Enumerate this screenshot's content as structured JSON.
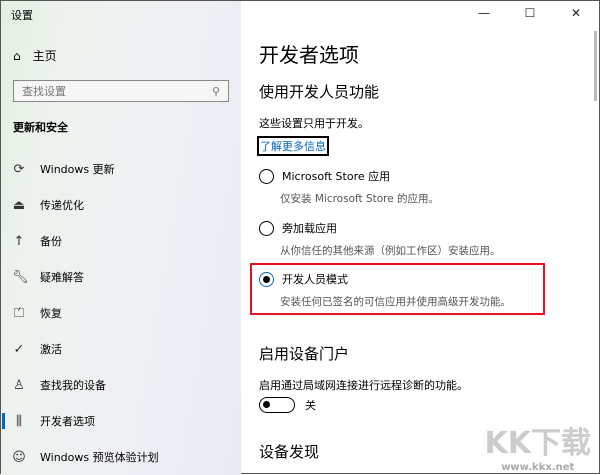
{
  "window": {
    "title": "设置",
    "minimize": "—",
    "maximize": "☐",
    "close": "✕"
  },
  "sidebar": {
    "home": "主页",
    "search_placeholder": "查找设置",
    "section": "更新和安全",
    "items": [
      {
        "label": "Windows 更新",
        "icon": "refresh-icon"
      },
      {
        "label": "传递优化",
        "icon": "delivery-icon"
      },
      {
        "label": "备份",
        "icon": "upload-arrow-icon"
      },
      {
        "label": "疑难解答",
        "icon": "wrench-icon"
      },
      {
        "label": "恢复",
        "icon": "recovery-icon"
      },
      {
        "label": "激活",
        "icon": "check-circle-icon"
      },
      {
        "label": "查找我的设备",
        "icon": "person-pin-icon"
      },
      {
        "label": "开发者选项",
        "icon": "developer-icon",
        "active": true
      },
      {
        "label": "Windows 预览体验计划",
        "icon": "cat-icon"
      }
    ]
  },
  "main": {
    "title": "开发者选项",
    "section1": "使用开发人员功能",
    "note": "这些设置只用于开发。",
    "link": "了解更多信息",
    "options": [
      {
        "label": "Microsoft Store 应用",
        "desc": "仅安装 Microsoft Store 的应用。",
        "selected": false
      },
      {
        "label": "旁加载应用",
        "desc": "从你信任的其他来源（例如工作区）安装应用。",
        "selected": false
      },
      {
        "label": "开发人员模式",
        "desc": "安装任何已签名的可信应用并使用高级开发功能。",
        "selected": true
      }
    ],
    "section2": "启用设备门户",
    "portal_desc": "启用通过局域网连接进行远程诊断的功能。",
    "toggle_state": "关",
    "section3": "设备发现"
  },
  "watermark": {
    "logo": "KK下载",
    "url": "www.kkx.net"
  },
  "colors": {
    "accent": "#0067c0",
    "highlight": "#e81123"
  }
}
